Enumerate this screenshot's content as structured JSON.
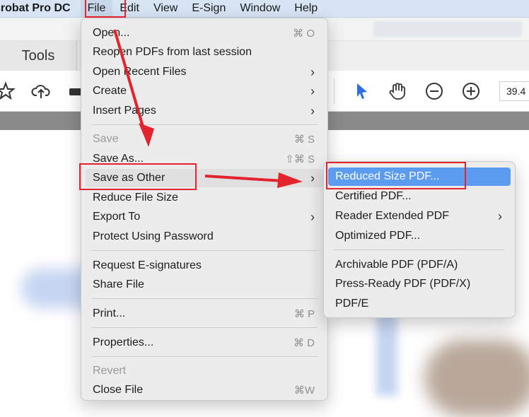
{
  "menubar": {
    "app_name": "crobat Pro DC",
    "items": [
      "File",
      "Edit",
      "View",
      "E-Sign",
      "Window",
      "Help"
    ]
  },
  "acrobat": {
    "tools_tab": "Tools",
    "zoom_value": "39.4"
  },
  "file_menu": {
    "open": {
      "label": "Open...",
      "shortcut": "⌘ O"
    },
    "reopen": {
      "label": "Reopen PDFs from last session"
    },
    "open_recent": {
      "label": "Open Recent Files"
    },
    "create": {
      "label": "Create"
    },
    "insert_pages": {
      "label": "Insert Pages"
    },
    "save": {
      "label": "Save",
      "shortcut": "⌘ S"
    },
    "save_as": {
      "label": "Save As...",
      "shortcut": "⇧⌘ S"
    },
    "save_as_other": {
      "label": "Save as Other"
    },
    "reduce_file_size": {
      "label": "Reduce File Size"
    },
    "export_to": {
      "label": "Export To"
    },
    "protect_password": {
      "label": "Protect Using Password"
    },
    "request_esignatures": {
      "label": "Request E-signatures"
    },
    "share_file": {
      "label": "Share File"
    },
    "print": {
      "label": "Print...",
      "shortcut": "⌘ P"
    },
    "properties": {
      "label": "Properties...",
      "shortcut": "⌘ D"
    },
    "revert": {
      "label": "Revert"
    },
    "close_file": {
      "label": "Close File",
      "shortcut": "⌘W"
    }
  },
  "submenu": {
    "reduced_size_pdf": "Reduced Size PDF...",
    "certified_pdf": "Certified PDF...",
    "reader_extended_pdf": "Reader Extended PDF",
    "optimized_pdf": "Optimized PDF...",
    "archivable_pdf": "Archivable PDF (PDF/A)",
    "press_ready_pdf": "Press-Ready PDF (PDF/X)",
    "pdf_e": "PDF/E"
  },
  "colors": {
    "highlight": "#5b9cf0",
    "annotation_red": "#e3232d",
    "menubar_bg": "#d6e4f4"
  }
}
